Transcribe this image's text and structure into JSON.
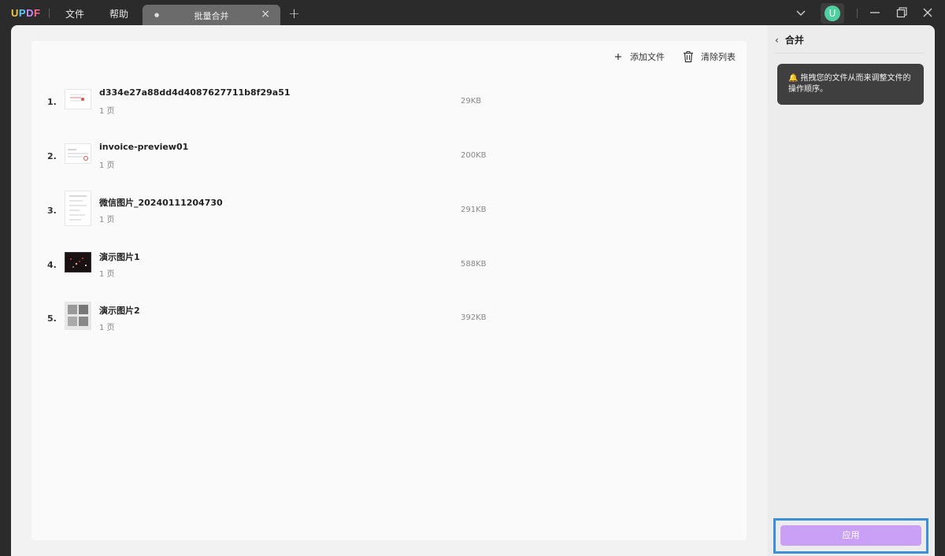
{
  "app": {
    "logo_text": "UPDF",
    "menus": [
      "文件",
      "帮助"
    ],
    "tab_title": "批量合并"
  },
  "toolbar": {
    "add_file_label": "添加文件",
    "clear_list_label": "清除列表"
  },
  "files": [
    {
      "index": "1.",
      "name": "d334e27a88dd4d4087627711b8f29a51",
      "pages": "1 页",
      "size": "29KB"
    },
    {
      "index": "2.",
      "name": "invoice-preview01",
      "pages": "1 页",
      "size": "200KB"
    },
    {
      "index": "3.",
      "name": "微信图片_20240111204730",
      "pages": "1 页",
      "size": "291KB"
    },
    {
      "index": "4.",
      "name": "演示图片1",
      "pages": "1 页",
      "size": "588KB"
    },
    {
      "index": "5.",
      "name": "演示图片2",
      "pages": "1 页",
      "size": "392KB"
    }
  ],
  "panel": {
    "title": "合并",
    "tip": "拖拽您的文件从而来调整文件的操作顺序。",
    "apply_label": "应用"
  },
  "user": {
    "avatar_letter": "U"
  },
  "colors": {
    "accent": "#c9a0f5",
    "highlight": "#3a8fd8",
    "avatar": "#4fd0a0"
  }
}
